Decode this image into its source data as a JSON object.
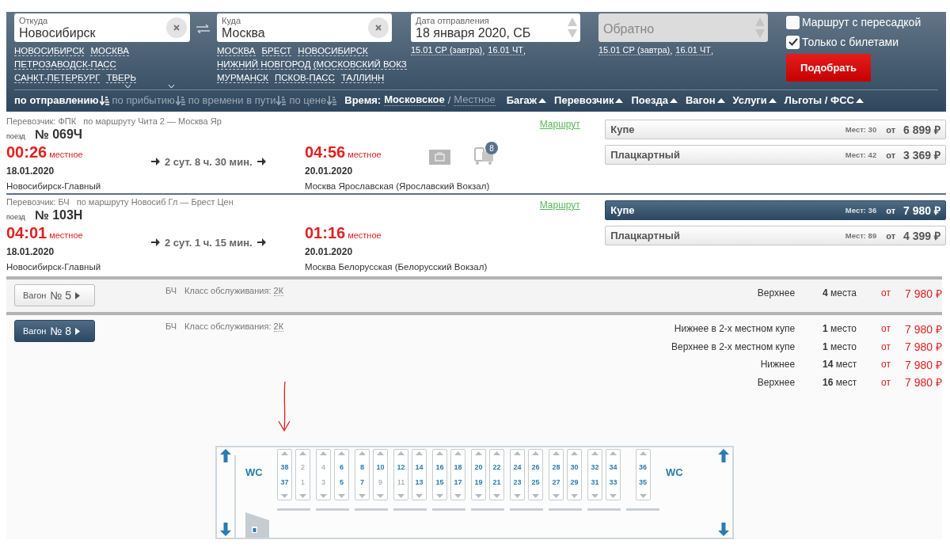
{
  "search": {
    "from": {
      "label": "Откуда",
      "value": "Новосибирск",
      "suggestion_lines": [
        [
          "НОВОСИБИРСК",
          "МОСКВА"
        ],
        [
          "ПЕТРОЗАВОДСК-ПАСС"
        ],
        [
          "САНКТ-ПЕТЕРБУРГ",
          "ТВЕРЬ"
        ]
      ]
    },
    "to": {
      "label": "Куда",
      "value": "Москва",
      "suggestion_lines": [
        [
          "МОСКВА",
          "БРЕСТ",
          "НОВОСИБИРСК"
        ],
        [
          "НИЖНИЙ НОВГОРОД (МОСКОВСКИЙ ВОКЗ"
        ],
        [
          "МУРМАНСК",
          "ПСКОВ-ПАСС",
          "ТАЛЛИНН"
        ]
      ]
    },
    "date": {
      "label": "Дата отправления",
      "value": "18 января 2020, СБ",
      "quick_dates": [
        {
          "text": "15.01 СР (завтра)",
          "sep": ","
        },
        {
          "text": "16.01 ЧТ",
          "sep": ","
        }
      ]
    },
    "return": {
      "placeholder": "Обратно",
      "disabled": true,
      "quick_dates": [
        {
          "text": "15.01 СР (завтра)",
          "sep": ","
        },
        {
          "text": "16.01 ЧТ",
          "sep": ","
        }
      ]
    },
    "options": [
      {
        "label": "Маршрут с пересадкой",
        "checked": false
      },
      {
        "label": "Только с билетами",
        "checked": true
      }
    ],
    "submit": "Подобрать"
  },
  "sort": [
    {
      "label": "по отправлению",
      "selected": true
    },
    {
      "label": "по прибытию",
      "selected": false
    },
    {
      "label": "по времени в пути",
      "selected": false
    },
    {
      "label": "по цене",
      "selected": false
    }
  ],
  "time": {
    "label": "Время:",
    "separator": "/",
    "options": [
      {
        "label": "Московское",
        "selected": true
      },
      {
        "label": "Местное",
        "selected": false
      }
    ]
  },
  "filters": [
    "Багаж",
    "Перевозчик",
    "Поезда",
    "Вагон",
    "Услуги",
    "Льготы / ФСС"
  ],
  "trains": [
    {
      "carrier": "Перевозчик: ФПК",
      "route": "по маршруту Чита 2 — Москва Яр",
      "train_label": "поезд",
      "number": "№ 069Ч",
      "departure": {
        "time": "00:26",
        "zone": "местное",
        "date": "18.01.2020",
        "station": "Новосибирск-Главный"
      },
      "duration": "2 сут. 8 ч. 30 мин.",
      "arrival": {
        "time": "04:56",
        "zone": "местное",
        "date": "20.01.2020",
        "station": "Москва Ярославская (Ярославский Вокзал)"
      },
      "luggage_badge": "8",
      "route_link": "Маршрут",
      "classes": [
        {
          "name": "Купе",
          "seats": "Мест: 30",
          "from": "от",
          "price": "6 899 ₽",
          "selected": false
        },
        {
          "name": "Плацкартный",
          "seats": "Мест: 42",
          "from": "от",
          "price": "3 369 ₽",
          "selected": false
        }
      ]
    },
    {
      "carrier": "Перевозчик: БЧ",
      "route": "по маршруту Новосиб Гл — Брест Цен",
      "train_label": "поезд",
      "number": "№ 103Н",
      "departure": {
        "time": "04:01",
        "zone": "местное",
        "date": "18.01.2020",
        "station": "Новосибирск-Главный"
      },
      "duration": "2 сут. 1 ч. 15 мин.",
      "arrival": {
        "time": "01:16",
        "zone": "местное",
        "date": "20.01.2020",
        "station": "Москва Белорусская (Белорусский Вокзал)"
      },
      "route_link": "Маршрут",
      "classes": [
        {
          "name": "Купе",
          "seats": "Мест: 36",
          "from": "от",
          "price": "7 980 ₽",
          "selected": true
        },
        {
          "name": "Плацкартный",
          "seats": "Мест: 89",
          "from": "от",
          "price": "4 399 ₽",
          "selected": false
        }
      ]
    }
  ],
  "cars": [
    {
      "label": "Вагон",
      "number": "№ 5",
      "selected": false,
      "carrier": "БЧ",
      "class_label": "Класс обслуживания:",
      "class_value": "2К",
      "offers": [
        {
          "type": "Верхнее",
          "count": "**4** места",
          "from": "от",
          "price": "7 980 ₽"
        }
      ]
    },
    {
      "label": "Вагон",
      "number": "№ 8",
      "selected": true,
      "carrier": "БЧ",
      "class_label": "Класс обслуживания:",
      "class_value": "2К",
      "offers": [
        {
          "type": "Нижнее в 2-х местном купе",
          "count": "**1** место",
          "from": "от",
          "price": "7 980 ₽"
        },
        {
          "type": "Верхнее в 2-х местном купе",
          "count": "**1** место",
          "from": "от",
          "price": "7 980 ₽"
        },
        {
          "type": "Нижнее",
          "count": "**14** мест",
          "from": "от",
          "price": "7 980 ₽"
        },
        {
          "type": "Верхнее",
          "count": "**16** мест",
          "from": "от",
          "price": "7 980 ₽"
        }
      ],
      "seat_map": {
        "wc_left": "WC",
        "wc_right": "WC",
        "compartments": [
          [
            {
              "upper": {
                "number": "38",
                "available": true
              },
              "lower": {
                "number": "37",
                "available": true
              }
            },
            {
              "upper": {
                "number": "2",
                "available": false
              },
              "lower": {
                "number": "1",
                "available": false
              }
            }
          ],
          [
            {
              "upper": {
                "number": "4",
                "available": false
              },
              "lower": {
                "number": "3",
                "available": false
              }
            },
            {
              "upper": {
                "number": "6",
                "available": true
              },
              "lower": {
                "number": "5",
                "available": true
              }
            }
          ],
          [
            {
              "upper": {
                "number": "8",
                "available": true
              },
              "lower": {
                "number": "7",
                "available": true
              }
            },
            {
              "upper": {
                "number": "10",
                "available": true
              },
              "lower": {
                "number": "9",
                "available": false
              }
            }
          ],
          [
            {
              "upper": {
                "number": "12",
                "available": true
              },
              "lower": {
                "number": "11",
                "available": false
              }
            },
            {
              "upper": {
                "number": "14",
                "available": true
              },
              "lower": {
                "number": "13",
                "available": true
              }
            }
          ],
          [
            {
              "upper": {
                "number": "16",
                "available": true
              },
              "lower": {
                "number": "15",
                "available": true
              }
            },
            {
              "upper": {
                "number": "18",
                "available": true
              },
              "lower": {
                "number": "17",
                "available": true
              }
            }
          ],
          [
            {
              "upper": {
                "number": "20",
                "available": true
              },
              "lower": {
                "number": "19",
                "available": true
              }
            },
            {
              "upper": {
                "number": "22",
                "available": true
              },
              "lower": {
                "number": "21",
                "available": true
              }
            }
          ],
          [
            {
              "upper": {
                "number": "24",
                "available": true
              },
              "lower": {
                "number": "23",
                "available": true
              }
            },
            {
              "upper": {
                "number": "26",
                "available": true
              },
              "lower": {
                "number": "25",
                "available": true
              }
            }
          ],
          [
            {
              "upper": {
                "number": "28",
                "available": true
              },
              "lower": {
                "number": "27",
                "available": true
              }
            },
            {
              "upper": {
                "number": "30",
                "available": true
              },
              "lower": {
                "number": "29",
                "available": true
              }
            }
          ],
          [
            {
              "upper": {
                "number": "32",
                "available": true
              },
              "lower": {
                "number": "31",
                "available": true
              }
            },
            {
              "upper": {
                "number": "34",
                "available": true
              },
              "lower": {
                "number": "33",
                "available": true
              }
            }
          ],
          [
            {
              "upper": {
                "number": "36",
                "available": true
              },
              "lower": {
                "number": "35",
                "available": true
              }
            }
          ]
        ]
      }
    }
  ]
}
